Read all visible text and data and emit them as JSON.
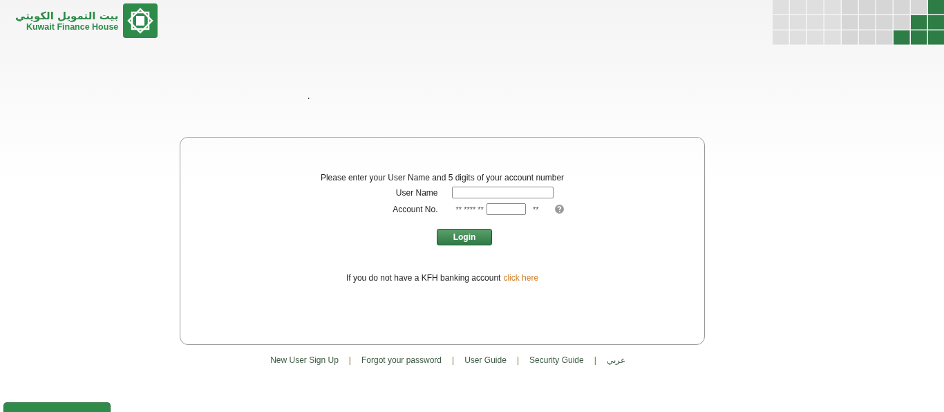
{
  "header": {
    "logo_arabic": "بيت التمويل الكويتي",
    "logo_english": "Kuwait Finance House"
  },
  "note": ".",
  "login": {
    "prompt": "Please enter your User Name and 5 digits of your account number",
    "fields": [
      {
        "label": "User Name",
        "kind": "text"
      },
      {
        "label": "Account No.",
        "kind": "account",
        "prefix": "** **** **",
        "suffix": "**"
      }
    ],
    "button": "Login",
    "signup_text": "If you do not have a KFH banking account",
    "signup_link": "click here"
  },
  "footer_links": [
    {
      "kind": "link",
      "text": "New User Sign Up"
    },
    {
      "kind": "separator",
      "text": "|"
    },
    {
      "kind": "link",
      "text": "Forgot your password"
    },
    {
      "kind": "separator",
      "text": "|"
    },
    {
      "kind": "link",
      "text": "User Guide"
    },
    {
      "kind": "separator",
      "text": "|"
    },
    {
      "kind": "link",
      "text": "Security Guide"
    },
    {
      "kind": "separator",
      "text": "|"
    },
    {
      "kind": "link",
      "text": "عربي"
    }
  ]
}
